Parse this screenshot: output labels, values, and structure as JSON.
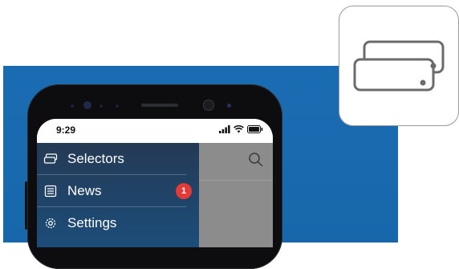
{
  "status_bar": {
    "time": "9:29"
  },
  "drawer": {
    "items": [
      {
        "label": "Selectors",
        "icon": "selectors-icon"
      },
      {
        "label": "News",
        "icon": "news-icon",
        "badge": "1"
      },
      {
        "label": "Settings",
        "icon": "gear-icon"
      }
    ]
  },
  "colors": {
    "background_blue": "#1a6cb2",
    "badge_red": "#e53935",
    "drawer": "#243a55"
  }
}
